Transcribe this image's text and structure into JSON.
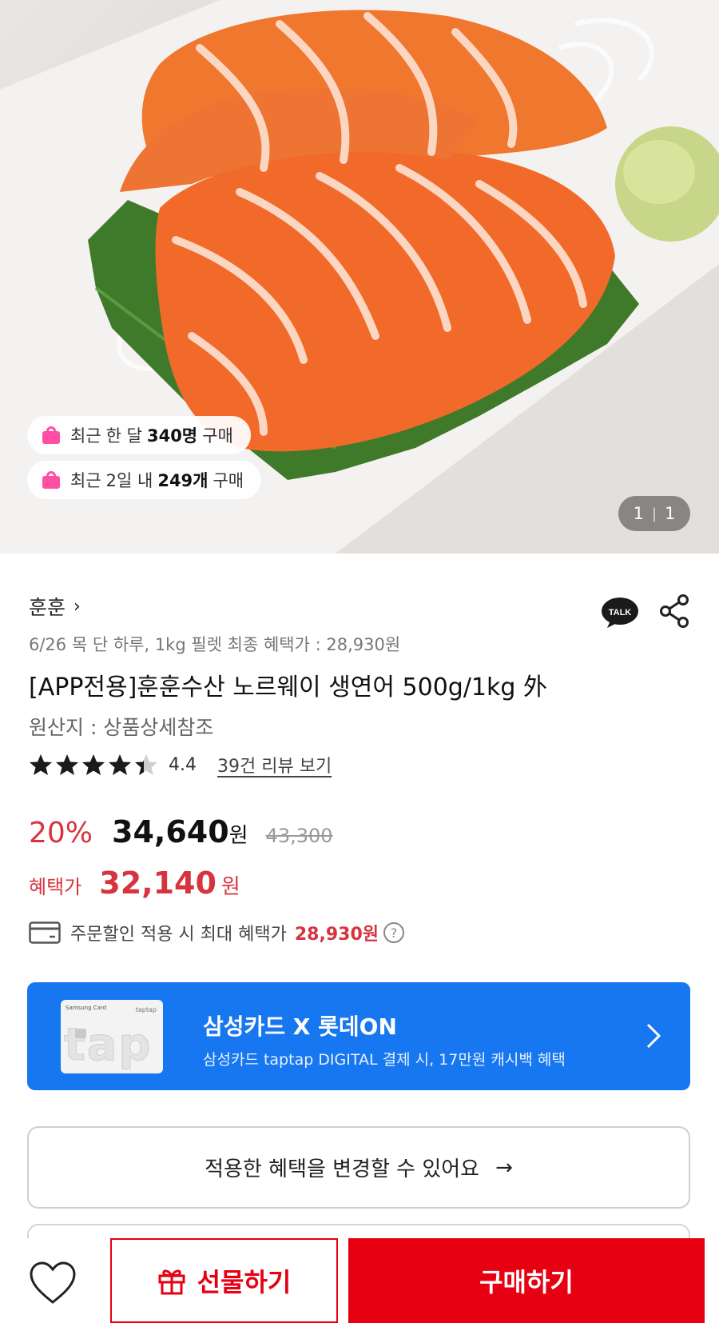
{
  "hero": {
    "image_alt": "salmon sashimi on perilla leaves",
    "badges": [
      {
        "prefix": "최근",
        "mid": "한 달",
        "value": "340명",
        "suffix": "구매"
      },
      {
        "prefix": "최근",
        "mid": "2일 내",
        "value": "249개",
        "suffix": "구매"
      }
    ],
    "counter": {
      "current": "1",
      "total": "1"
    }
  },
  "product": {
    "seller": "훈훈",
    "promo_text": "6/26 목 단 하루, 1kg 필렛 최종 혜택가 : 28,930원",
    "title": "[APP전용]훈훈수산 노르웨이 생연어 500g/1kg 外",
    "origin": "원산지 : 상품상세참조",
    "rating": 4.4,
    "rating_label": "4.4",
    "review_link": "39건 리뷰 보기"
  },
  "price": {
    "discount": "20%",
    "sale_price": "34,640",
    "currency": "원",
    "original_price": "43,300",
    "benefit_label": "혜택가",
    "benefit_price": "32,140",
    "benefit_currency": "원",
    "max_benefit_label": "주문할인 적용 시 최대 혜택가",
    "max_benefit_value": "28,930원",
    "help_glyph": "?"
  },
  "banner": {
    "title": "삼성카드 X 롯데ON",
    "subtitle": "삼성카드 taptap DIGITAL 결제 시, 17만원 캐시백 혜택",
    "card_brand": "Samsung Card",
    "card_tag": "taptap",
    "card_text": "tap",
    "bg_color": "#1677f0"
  },
  "change_benefits": {
    "label": "적용한 혜택을 변경할 수 있어요",
    "arrow": "→"
  },
  "bottom_bar": {
    "gift_label": "선물하기",
    "buy_label": "구매하기",
    "accent_color": "#e60012"
  },
  "icons": {
    "talk": "TALK",
    "share": "share-icon",
    "wish": "heart-icon",
    "gift": "gift-icon",
    "card": "card-icon"
  },
  "colors": {
    "discount_red": "#d6343f",
    "badge_pink": "#ff4fa3"
  }
}
